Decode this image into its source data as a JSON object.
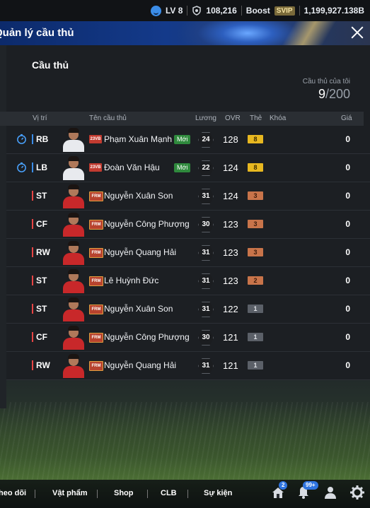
{
  "topbar": {
    "level": "LV 8",
    "points": "108,216",
    "boost_label": "Boost",
    "svip_label": "SVIP",
    "coins": "1,199,927.138B"
  },
  "header": {
    "title": "Quản lý cầu thủ"
  },
  "section": {
    "title": "Cầu thủ",
    "count_label": "Cầu thủ của tôi",
    "count_current": "9",
    "count_max": "/200"
  },
  "table": {
    "columns": {
      "position": "Vị trí",
      "name": "Tên cầu thủ",
      "salary": "Lương",
      "ovr": "OVR",
      "card": "Thẻ",
      "lock": "Khóa",
      "price": "Giá"
    },
    "rows": [
      {
        "pos": "RB",
        "pos_color": "#3b8de8",
        "name": "Phạm Xuân Mạnh",
        "season": "23VB",
        "new": "Mới",
        "salary": "24",
        "ovr": "128",
        "level": "8",
        "level_style": "gold",
        "price": "0",
        "timer": true,
        "kit": "white"
      },
      {
        "pos": "LB",
        "pos_color": "#3b8de8",
        "name": "Đoàn Văn Hậu",
        "season": "23VB",
        "new": "Mới",
        "salary": "22",
        "ovr": "124",
        "level": "8",
        "level_style": "gold",
        "price": "0",
        "timer": true,
        "kit": "white"
      },
      {
        "pos": "ST",
        "pos_color": "#e84545",
        "name": "Nguyễn Xuân Son",
        "season": "FRM",
        "new": "",
        "salary": "31",
        "ovr": "124",
        "level": "3",
        "level_style": "bronze",
        "price": "0",
        "timer": false,
        "kit": "red"
      },
      {
        "pos": "CF",
        "pos_color": "#e84545",
        "name": "Nguyễn Công Phượng",
        "season": "FRM",
        "new": "",
        "salary": "30",
        "ovr": "123",
        "level": "3",
        "level_style": "bronze",
        "price": "0",
        "timer": false,
        "kit": "red"
      },
      {
        "pos": "RW",
        "pos_color": "#e84545",
        "name": "Nguyễn Quang Hải",
        "season": "FRM",
        "new": "",
        "salary": "31",
        "ovr": "123",
        "level": "3",
        "level_style": "bronze",
        "price": "0",
        "timer": false,
        "kit": "red"
      },
      {
        "pos": "ST",
        "pos_color": "#e84545",
        "name": "Lê Huỳnh Đức",
        "season": "FRM",
        "new": "",
        "salary": "31",
        "ovr": "123",
        "level": "2",
        "level_style": "bronze",
        "price": "0",
        "timer": false,
        "kit": "red"
      },
      {
        "pos": "ST",
        "pos_color": "#e84545",
        "name": "Nguyễn Xuân Son",
        "season": "FRM",
        "new": "",
        "salary": "31",
        "ovr": "122",
        "level": "1",
        "level_style": "gray",
        "price": "0",
        "timer": false,
        "kit": "red"
      },
      {
        "pos": "CF",
        "pos_color": "#e84545",
        "name": "Nguyễn Công Phượng",
        "season": "FRM",
        "new": "",
        "salary": "30",
        "ovr": "121",
        "level": "1",
        "level_style": "gray",
        "price": "0",
        "timer": false,
        "kit": "red"
      },
      {
        "pos": "RW",
        "pos_color": "#e84545",
        "name": "Nguyễn Quang Hải",
        "season": "FRM",
        "new": "",
        "salary": "31",
        "ovr": "121",
        "level": "1",
        "level_style": "gray",
        "price": "0",
        "timer": false,
        "kit": "red"
      }
    ]
  },
  "nav": {
    "items": [
      "heo dõi",
      "Vật phẩm",
      "Shop",
      "CLB",
      "Sự kiện"
    ],
    "home_badge": "2",
    "notif_badge": "99+"
  },
  "colors": {
    "gold": "#e8b820",
    "bronze": "#c8744a",
    "gray": "#5b6068",
    "season_vb": "#c23b30",
    "season_frm": "#b8432e"
  }
}
